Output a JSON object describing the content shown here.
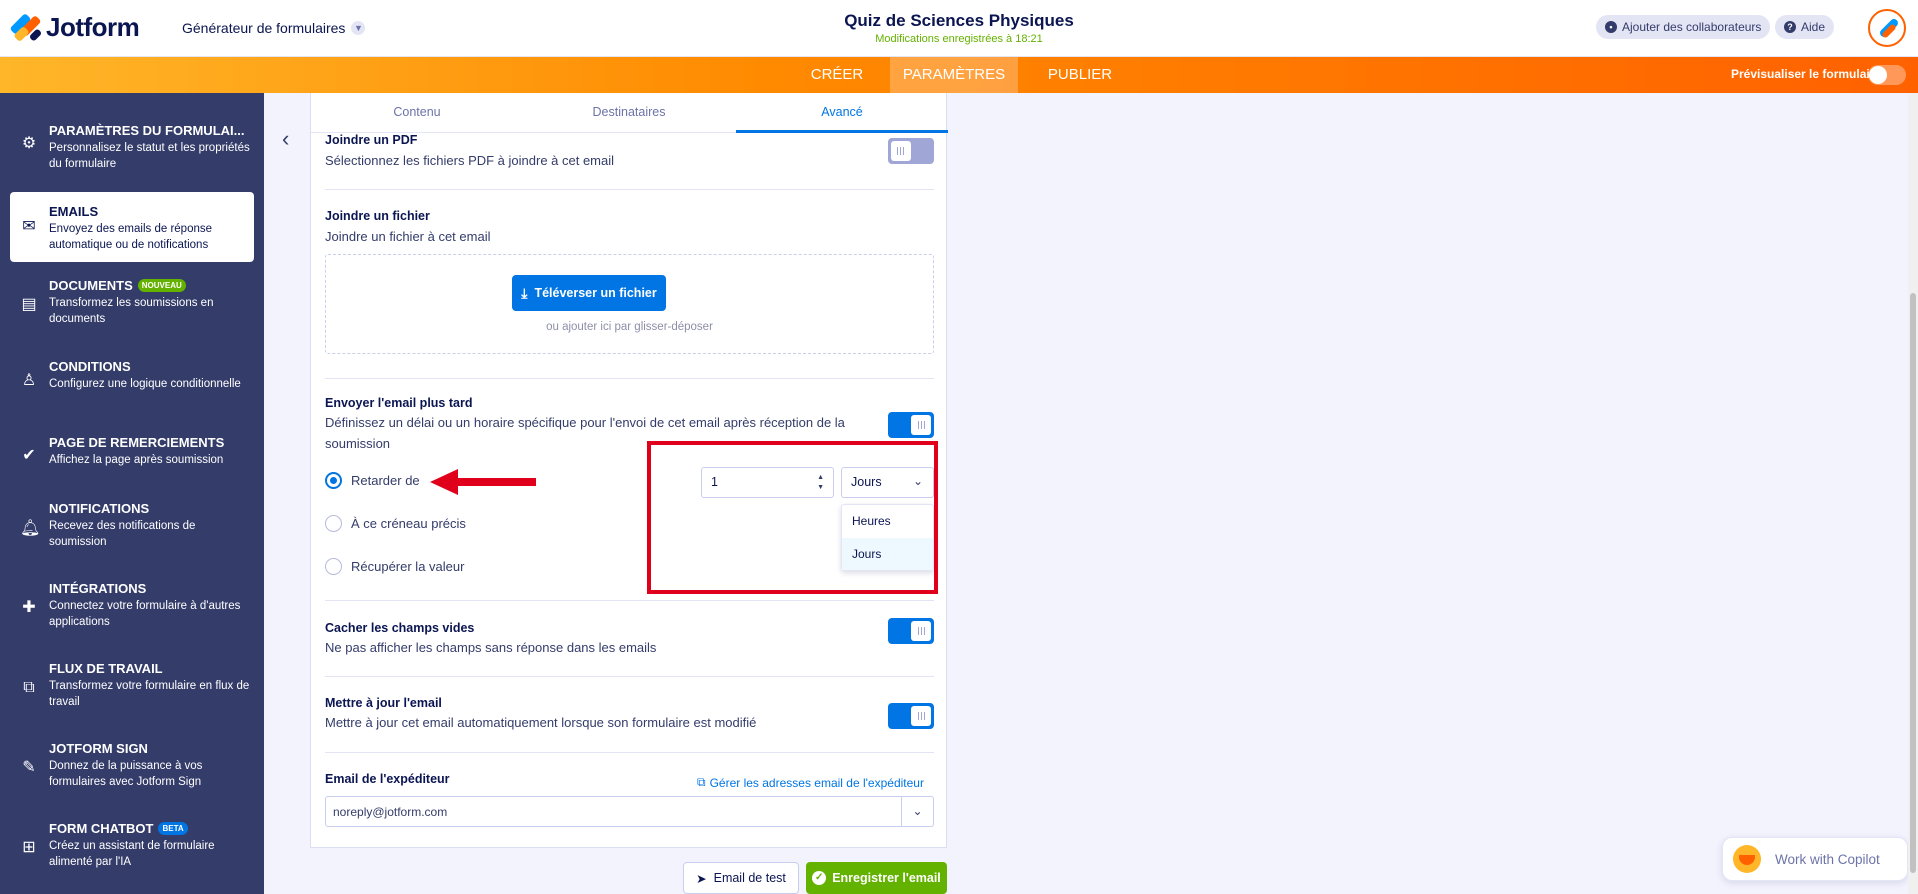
{
  "header": {
    "logo_text": "Jotform",
    "builder_label": "Générateur de formulaires",
    "form_title": "Quiz de Sciences Physiques",
    "saved_status": "Modifications enregistrées à 18:21",
    "add_collaborators": "Ajouter des collaborateurs",
    "help": "Aide"
  },
  "nav": {
    "tabs": [
      "CRÉER",
      "PARAMÈTRES",
      "PUBLIER"
    ],
    "active_tab": "PARAMÈTRES",
    "preview_label": "Prévisualiser le formulaire"
  },
  "sidebar": {
    "items": [
      {
        "title": "PARAMÈTRES DU FORMULAI...",
        "desc": "Personnalisez le statut et les propriétés du formulaire",
        "icon": "gear-icon"
      },
      {
        "title": "EMAILS",
        "desc": "Envoyez des emails de réponse automatique ou de notifications",
        "icon": "mail-icon",
        "active": true
      },
      {
        "title": "DOCUMENTS",
        "badge": "NOUVEAU",
        "desc": "Transformez les soumissions en documents",
        "icon": "document-icon"
      },
      {
        "title": "CONDITIONS",
        "desc": "Configurez une logique conditionnelle",
        "icon": "hierarchy-icon"
      },
      {
        "title": "PAGE DE REMERCIEMENTS",
        "desc": "Affichez la page après soumission",
        "icon": "check-circle-icon"
      },
      {
        "title": "NOTIFICATIONS",
        "desc": "Recevez des notifications de soumission",
        "icon": "bell-icon"
      },
      {
        "title": "INTÉGRATIONS",
        "desc": "Connectez votre formulaire à d'autres applications",
        "icon": "puzzle-icon"
      },
      {
        "title": "FLUX DE TRAVAIL",
        "desc": "Transformez votre formulaire en flux de travail",
        "icon": "workflow-icon"
      },
      {
        "title": "JOTFORM SIGN",
        "desc": "Donnez de la puissance à vos formulaires avec Jotform Sign",
        "icon": "pen-icon"
      },
      {
        "title": "FORM CHATBOT",
        "badge": "BETA",
        "desc": "Créez un assistant de formulaire alimenté par l'IA",
        "icon": "chatbot-icon"
      }
    ]
  },
  "tabs": [
    "Contenu",
    "Destinataires",
    "Avancé"
  ],
  "active_tab": "Avancé",
  "sections": {
    "pdf": {
      "title": "Joindre un PDF",
      "desc": "Sélectionnez les fichiers PDF à joindre à cet email",
      "toggle": "off"
    },
    "file": {
      "title": "Joindre un fichier",
      "desc": "Joindre un fichier à cet email",
      "upload_label": "Téléverser un fichier",
      "drop_hint": "ou ajouter ici par glisser-déposer"
    },
    "later": {
      "title": "Envoyer l'email plus tard",
      "desc_line1": "Définissez un délai ou un horaire spécifique pour l'envoi de cet email après réception de la",
      "desc_line2": "soumission",
      "toggle": "on",
      "options": [
        "Retarder de",
        "À ce créneau précis",
        "Récupérer la valeur"
      ],
      "selected_option": "Retarder de",
      "delay_value": "1",
      "unit_value": "Jours",
      "unit_options": [
        "Heures",
        "Jours"
      ]
    },
    "hide_empty": {
      "title": "Cacher les champs vides",
      "desc": "Ne pas afficher les champs sans réponse dans les emails",
      "toggle": "on"
    },
    "update": {
      "title": "Mettre à jour l'email",
      "desc": "Mettre à jour cet email automatiquement lorsque son formulaire est modifié",
      "toggle": "on"
    },
    "sender": {
      "title": "Email de l'expéditeur",
      "manage_link": "Gérer les adresses email de l'expéditeur",
      "value": "noreply@jotform.com"
    }
  },
  "footer": {
    "test_label": "Email de test",
    "save_label": "Enregistrer l'email"
  },
  "copilot": {
    "label": "Work with Copilot"
  },
  "colors": {
    "accent": "#0075e3",
    "orange": "#ff6100",
    "sidebar": "#343c6a",
    "success": "#64b200",
    "annotation": "#e0001b"
  }
}
